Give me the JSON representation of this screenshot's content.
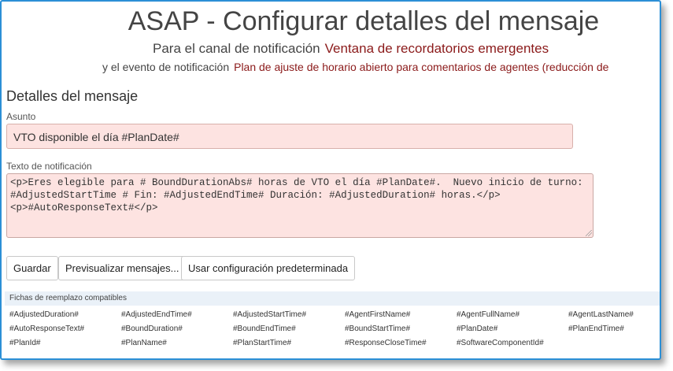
{
  "header": {
    "title": "ASAP - Configurar detalles del mensaje",
    "channel_prefix": "Para el canal de notificación",
    "channel_value": "Ventana de recordatorios emergentes",
    "event_prefix": "y el evento de notificación",
    "event_value": "Plan de ajuste de horario abierto para comentarios de agentes (reducción de"
  },
  "details": {
    "section_title": "Detalles del mensaje",
    "subject_label": "Asunto",
    "subject_value": "VTO disponible el día #PlanDate#",
    "body_label": "Texto de notificación",
    "body_value": "<p>Eres elegible para # BoundDurationAbs# horas de VTO el día #PlanDate#.  Nuevo inicio de turno: #AdjustedStartTime # Fin: #AdjustedEndTime# Duración: #AdjustedDuration# horas.</p>\n<p>#AutoResponseText#</p>"
  },
  "buttons": {
    "save": "Guardar",
    "preview": "Previsualizar mensajes...",
    "defaults": "Usar configuración predeterminada"
  },
  "tokens": {
    "header": "Fichas de reemplazo compatibles",
    "items": [
      "#AdjustedDuration#",
      "#AdjustedEndTime#",
      "#AdjustedStartTime#",
      "#AgentFirstName#",
      "#AgentFullName#",
      "#AgentLastName#",
      "#AutoResponseText#",
      "#BoundDuration#",
      "#BoundEndTime#",
      "#BoundStartTime#",
      "#PlanDate#",
      "#PlanEndTime#",
      "#PlanId#",
      "#PlanName#",
      "#PlanStartTime#",
      "#ResponseCloseTime#",
      "#SoftwareComponentId#"
    ]
  },
  "colors": {
    "accent_border": "#2b8fd6",
    "highlight_text": "#8b1a1a",
    "input_background": "#fde3e1"
  }
}
